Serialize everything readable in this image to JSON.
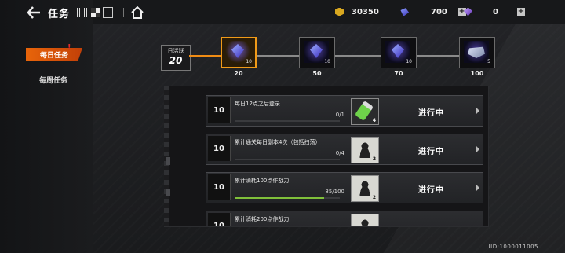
{
  "header": {
    "title": "任务",
    "resources": [
      {
        "icon": "gold-coin-icon",
        "value": "30350"
      },
      {
        "icon": "crystal-icon",
        "value": "700"
      },
      {
        "icon": "premium-crystal-icon",
        "value": "0"
      }
    ]
  },
  "sidebar": {
    "tabs": [
      {
        "label": "每日任务",
        "active": true,
        "badge": "!"
      },
      {
        "label": "每周任务",
        "active": false
      }
    ]
  },
  "activity": {
    "label": "日活跃",
    "value": "20",
    "chests": [
      {
        "threshold": "20",
        "count": "10",
        "reward_icon": "crystal-icon",
        "reached": true
      },
      {
        "threshold": "50",
        "count": "10",
        "reward_icon": "crystal-icon",
        "reached": false
      },
      {
        "threshold": "70",
        "count": "10",
        "reward_icon": "crystal-icon",
        "reached": false
      },
      {
        "threshold": "100",
        "count": "5",
        "reward_icon": "drone-icon",
        "reached": false
      }
    ]
  },
  "tasks": [
    {
      "points": "10",
      "name": "每日12点之后登录",
      "progress": "0/1",
      "fill": 0.0,
      "reward_count": "4",
      "reward_icon": "vial-icon",
      "status": "进行中"
    },
    {
      "points": "10",
      "name": "累计通关每日副本4次（包括扫荡）",
      "progress": "0/4",
      "fill": 0.0,
      "reward_count": "2",
      "reward_icon": "card-icon",
      "status": "进行中"
    },
    {
      "points": "10",
      "name": "累计消耗100点作战力",
      "progress": "85/100",
      "fill": 0.85,
      "reward_count": "2",
      "reward_icon": "card-icon",
      "status": "进行中"
    },
    {
      "points": "10",
      "name": "累计消耗200点作战力",
      "progress": "",
      "fill": 0.0,
      "reward_count": "",
      "reward_icon": "card-icon",
      "status": ""
    }
  ],
  "footer": {
    "uid": "UID:1000011005"
  },
  "colors": {
    "accent": "#f08c14",
    "progress": "#7fc03a",
    "tab_active": "#e8650a"
  }
}
